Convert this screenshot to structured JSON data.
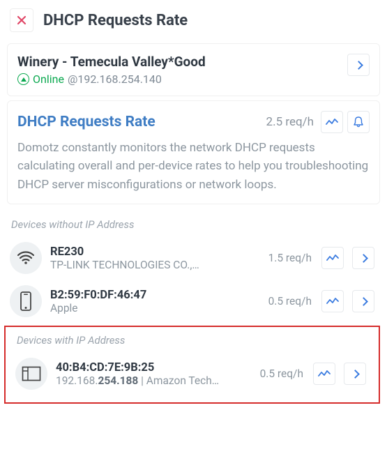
{
  "header": {
    "title": "DHCP Requests Rate"
  },
  "agent": {
    "title": "Winery - Temecula Valley*Good",
    "status": "Online",
    "ip_prefix": "@",
    "ip": "192.168.254.140"
  },
  "metric": {
    "title": "DHCP Requests Rate",
    "rate": "2.5 req/h",
    "description": "Domotz constantly monitors the network DHCP requests calculating overall and per-device rates to help you troubleshooting DHCP server misconfigurations or network loops."
  },
  "group_no_ip": {
    "label": "Devices without IP Address"
  },
  "group_with_ip": {
    "label": "Devices with IP Address"
  },
  "devices_no_ip": [
    {
      "name": "RE230",
      "sub": "TP-LINK TECHNOLOGIES CO.,…",
      "rate": "1.5 req/h"
    },
    {
      "name": "B2:59:F0:DF:46:47",
      "sub": "Apple",
      "rate": "0.5 req/h"
    }
  ],
  "devices_with_ip": [
    {
      "name": "40:B4:CD:7E:9B:25",
      "sub_pre": "192.168.",
      "sub_bold": "254.188",
      "sub_post": " | Amazon Tech…",
      "rate": "0.5 req/h"
    }
  ]
}
